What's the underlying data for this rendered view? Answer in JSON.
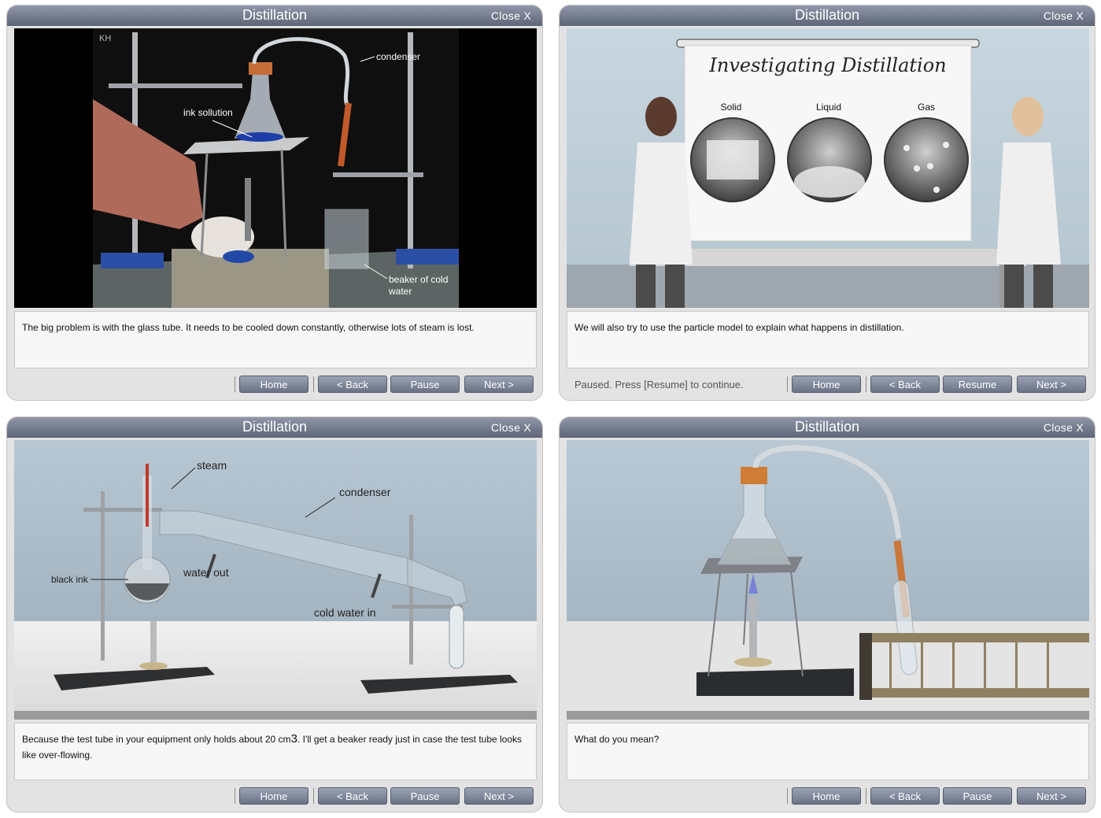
{
  "panels": [
    {
      "title": "Distillation",
      "close_label": "Close X",
      "scene": "video",
      "labels": {
        "condenser": "condenser",
        "ink": "ink sollution",
        "beaker1": "beaker of cold",
        "beaker2": "water",
        "watermark": "KH"
      },
      "caption": "The big problem is with the glass tube. It needs to be cooled down constantly, otherwise lots of steam is lost.",
      "status": "",
      "buttons": {
        "home": "Home",
        "back": "< Back",
        "pause": "Pause",
        "next": "Next >"
      }
    },
    {
      "title": "Distillation",
      "close_label": "Close X",
      "scene": "presenters",
      "labels": {
        "board_title": "Investigating Distillation",
        "solid": "Solid",
        "liquid": "Liquid",
        "gas": "Gas"
      },
      "caption": "We will also try to use the particle model to explain what happens in distillation.",
      "status": "Paused. Press [Resume] to continue.",
      "buttons": {
        "home": "Home",
        "back": "< Back",
        "pause": "Resume",
        "next": "Next >"
      }
    },
    {
      "title": "Distillation",
      "close_label": "Close X",
      "scene": "apparatus",
      "labels": {
        "steam": "steam",
        "condenser": "condenser",
        "water_out": "water out",
        "black_ink": "black ink",
        "cold_water_in": "cold water in"
      },
      "caption_pre": "Because the test tube in your equipment only holds about 20 cm",
      "caption_sup": "3",
      "caption_post": ". I'll get a beaker ready just in case the test tube looks like over-flowing.",
      "status": "",
      "buttons": {
        "home": "Home",
        "back": "< Back",
        "pause": "Pause",
        "next": "Next >"
      }
    },
    {
      "title": "Distillation",
      "close_label": "Close X",
      "scene": "flask",
      "caption": "What do you mean?",
      "status": "",
      "buttons": {
        "home": "Home",
        "back": "< Back",
        "pause": "Pause",
        "next": "Next >"
      }
    }
  ]
}
